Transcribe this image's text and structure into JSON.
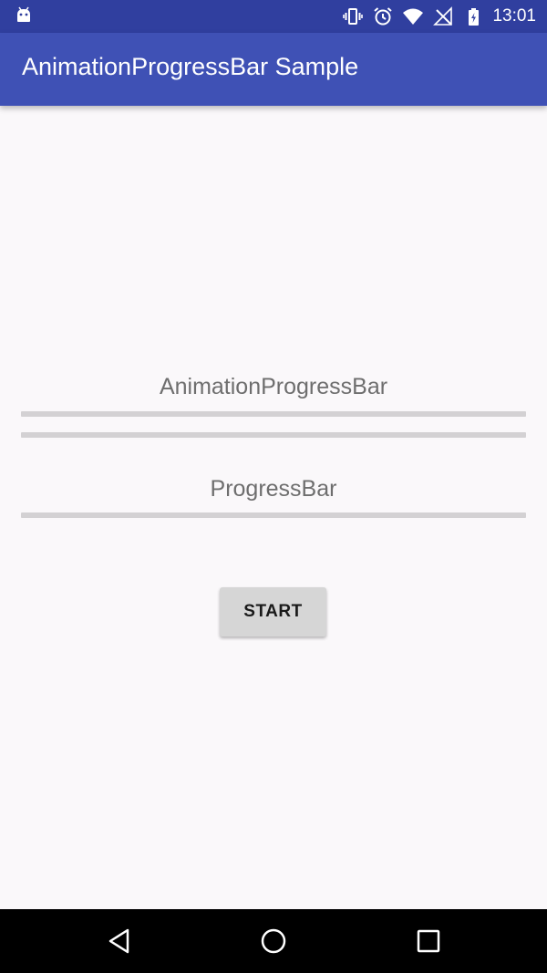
{
  "status_bar": {
    "time": "13:01",
    "icons": [
      "android-notification-icon",
      "vibrate-icon",
      "alarm-icon",
      "wifi-icon",
      "no-signal-icon",
      "battery-charging-icon"
    ]
  },
  "app_bar": {
    "title": "AnimationProgressBar Sample",
    "color": "#3f51b5",
    "status_color": "#303f9f"
  },
  "main": {
    "animation_progress": {
      "label": "AnimationProgressBar",
      "progress": 0
    },
    "progress_bar": {
      "label": "ProgressBar",
      "progress": 0
    },
    "start_button": {
      "label": "START"
    }
  },
  "nav_bar": {
    "buttons": [
      "back-icon",
      "home-icon",
      "recents-icon"
    ]
  },
  "colors": {
    "track": "#d3d1d3",
    "background": "#faf8fa"
  }
}
